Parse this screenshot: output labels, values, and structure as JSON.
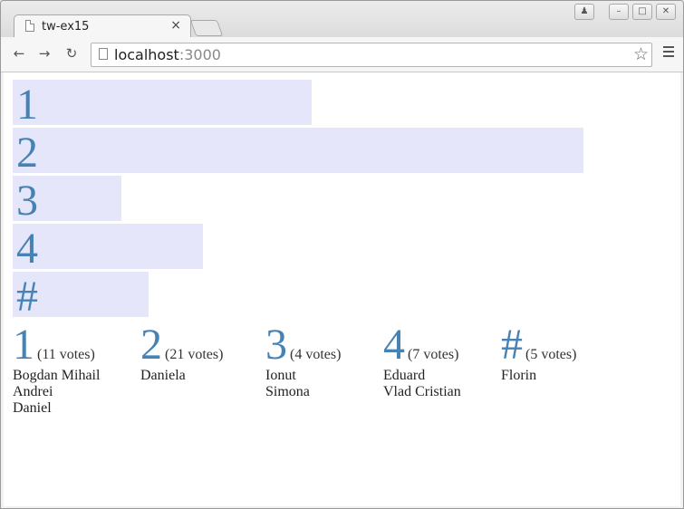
{
  "browser": {
    "tab_title": "tw-ex15",
    "tab_close": "×",
    "url_host": "localhost",
    "url_port": ":3000",
    "star": "☆"
  },
  "bars": [
    {
      "label": "1",
      "votes": 11
    },
    {
      "label": "2",
      "votes": 21
    },
    {
      "label": "3",
      "votes": 4
    },
    {
      "label": "4",
      "votes": 7
    },
    {
      "label": "#",
      "votes": 5
    }
  ],
  "results": [
    {
      "label": "1",
      "votes_text": "(11 votes)",
      "names": [
        "Bogdan Mihail",
        "Andrei",
        "Daniel"
      ]
    },
    {
      "label": "2",
      "votes_text": "(21 votes)",
      "names": [
        "Daniela"
      ]
    },
    {
      "label": "3",
      "votes_text": "(4 votes)",
      "names": [
        "Ionut",
        "Simona"
      ]
    },
    {
      "label": "4",
      "votes_text": "(7 votes)",
      "names": [
        "Eduard",
        "Vlad Cristian"
      ]
    },
    {
      "label": "#",
      "votes_text": "(5 votes)",
      "names": [
        "Florin"
      ]
    }
  ],
  "colors": {
    "bar_bg": "#e6e6fa",
    "label": "#4682b4"
  }
}
